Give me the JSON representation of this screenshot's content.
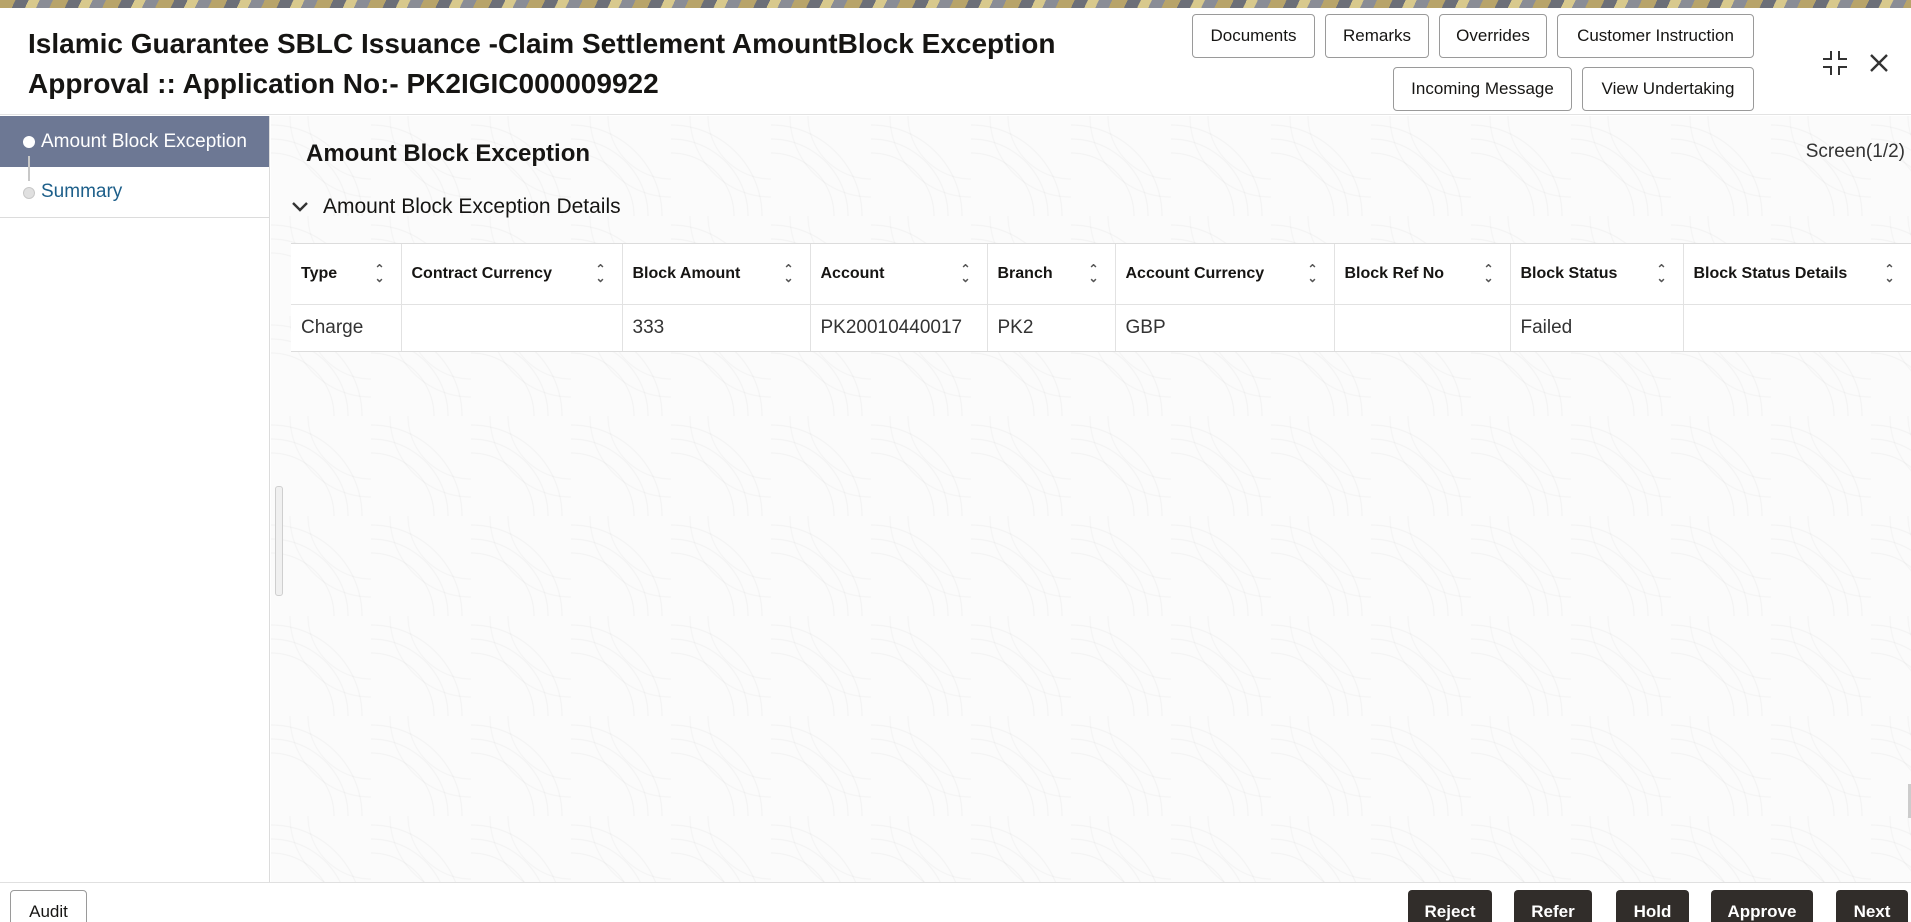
{
  "header": {
    "title_line1": "Islamic Guarantee SBLC Issuance -Claim Settlement AmountBlock Exception",
    "title_line2": "Approval :: Application No:- PK2IGIC000009922",
    "buttons": {
      "documents": "Documents",
      "remarks": "Remarks",
      "overrides": "Overrides",
      "customer_instruction": "Customer Instruction",
      "incoming_message": "Incoming Message",
      "view_undertaking": "View Undertaking"
    },
    "icons": {
      "minimize": "compress-icon",
      "close": "close-icon"
    }
  },
  "sidebar": {
    "items": [
      {
        "label": "Amount Block Exception",
        "active": true
      },
      {
        "label": "Summary",
        "active": false
      }
    ]
  },
  "main": {
    "page_title": "Amount Block Exception",
    "screen_indicator": "Screen(1/2)",
    "section_title": "Amount Block Exception Details",
    "table": {
      "columns": [
        "Type",
        "Contract Currency",
        "Block Amount",
        "Account",
        "Branch",
        "Account Currency",
        "Block Ref No",
        "Block Status",
        "Block Status Details"
      ],
      "rows": [
        [
          "Charge",
          "",
          "333",
          "PK20010440017",
          "PK2",
          "GBP",
          "",
          "Failed",
          ""
        ]
      ]
    }
  },
  "footer": {
    "audit": "Audit",
    "reject": "Reject",
    "refer": "Refer",
    "hold": "Hold",
    "approve": "Approve",
    "next": "Next"
  },
  "colors": {
    "sidebar_active": "#6d7894",
    "sidebar_link": "#1d5f8a",
    "footer_button": "#312d2a"
  }
}
